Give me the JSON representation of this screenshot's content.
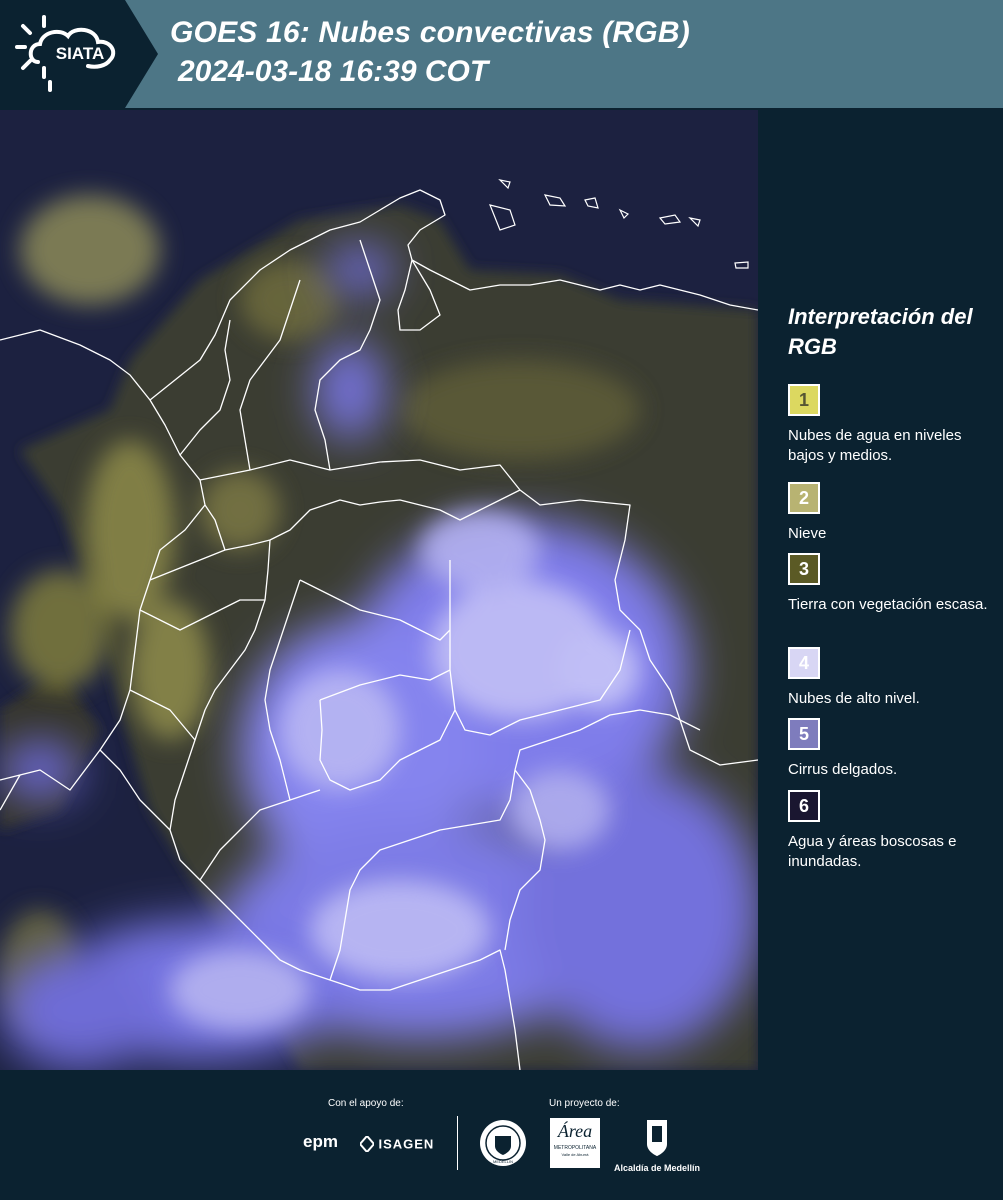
{
  "header": {
    "logo_text": "SIATA",
    "title": "GOES 16: Nubes convectivas (RGB)",
    "subtitle": "2024-03-18 16:39 COT"
  },
  "map": {
    "description_colors": {
      "background": "#1c2140",
      "land": "#3a3e2c",
      "low_clouds": "#a7a55f",
      "high_clouds": "#b8b8f4",
      "boundaries": "#ffffff"
    }
  },
  "legend": {
    "title": "Interpretación del RGB",
    "items": [
      {
        "number": "1",
        "color": "#dcd860",
        "text_color": "#555533",
        "label": "Nubes de agua en niveles bajos y medios."
      },
      {
        "number": "2",
        "color": "#b8b372",
        "text_color": "#ffffff",
        "label": "Nieve"
      },
      {
        "number": "3",
        "color": "#5b5a25",
        "text_color": "#ffffff",
        "label": "Tierra con vegetación escasa."
      },
      {
        "number": "4",
        "color": "#d8d6f4",
        "text_color": "#ffffff",
        "label": "Nubes de alto nivel."
      },
      {
        "number": "5",
        "color": "#7e7cbd",
        "text_color": "#ffffff",
        "label": "Cirrus delgados."
      },
      {
        "number": "6",
        "color": "#1a1630",
        "text_color": "#ffffff",
        "label": "Agua y áreas boscosas e inundadas."
      }
    ]
  },
  "footer": {
    "support_label": "Con el apoyo de:",
    "project_label": "Un proyecto de:",
    "epm": "epm",
    "isagen": "ISAGEN",
    "metropolitana": "METROPOLITANA",
    "metropolitana_sub": "Valle de Aburrá",
    "alcaldia": "Alcaldía de Medellín",
    "area_script": "Área",
    "seal_text": "MEDELLIN"
  }
}
